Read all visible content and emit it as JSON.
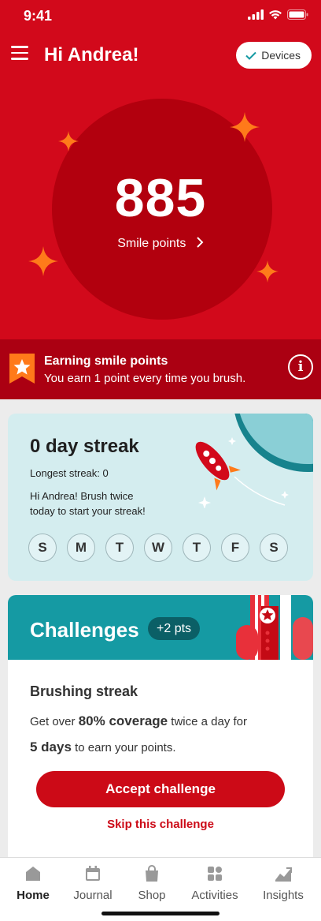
{
  "status_bar": {
    "time": "9:41"
  },
  "header": {
    "greeting": "Hi Andrea!",
    "devices_label": "Devices"
  },
  "points": {
    "value": "885",
    "label": "Smile points"
  },
  "earning": {
    "title": "Earning smile points",
    "subtitle": "You earn 1 point every time you brush."
  },
  "streak": {
    "title": "0 day streak",
    "longest": "Longest streak: 0",
    "message_line1": "Hi Andrea! Brush twice",
    "message_line2": "today to start your streak!",
    "days": [
      "S",
      "M",
      "T",
      "W",
      "T",
      "F",
      "S"
    ]
  },
  "challenges": {
    "title": "Challenges",
    "points_badge": "+2 pts",
    "name": "Brushing streak",
    "desc_part1": "Get over ",
    "desc_bold1": "80% coverage",
    "desc_part2": " twice a day for",
    "desc_bold2": "5 days",
    "desc_part3": " to earn your points.",
    "accept_label": "Accept challenge",
    "skip_label": "Skip this challenge"
  },
  "tabs": [
    {
      "label": "Home",
      "icon": "home-icon",
      "active": true
    },
    {
      "label": "Journal",
      "icon": "calendar-icon",
      "active": false
    },
    {
      "label": "Shop",
      "icon": "shopping-bag-icon",
      "active": false
    },
    {
      "label": "Activities",
      "icon": "grid-icon",
      "active": false
    },
    {
      "label": "Insights",
      "icon": "chart-icon",
      "active": false
    }
  ],
  "colors": {
    "brand_red": "#d2091b",
    "dark_red": "#ab0012",
    "teal": "#159aa3",
    "streak_bg": "#d4edef",
    "sparkle_orange": "#ff7a1a"
  }
}
